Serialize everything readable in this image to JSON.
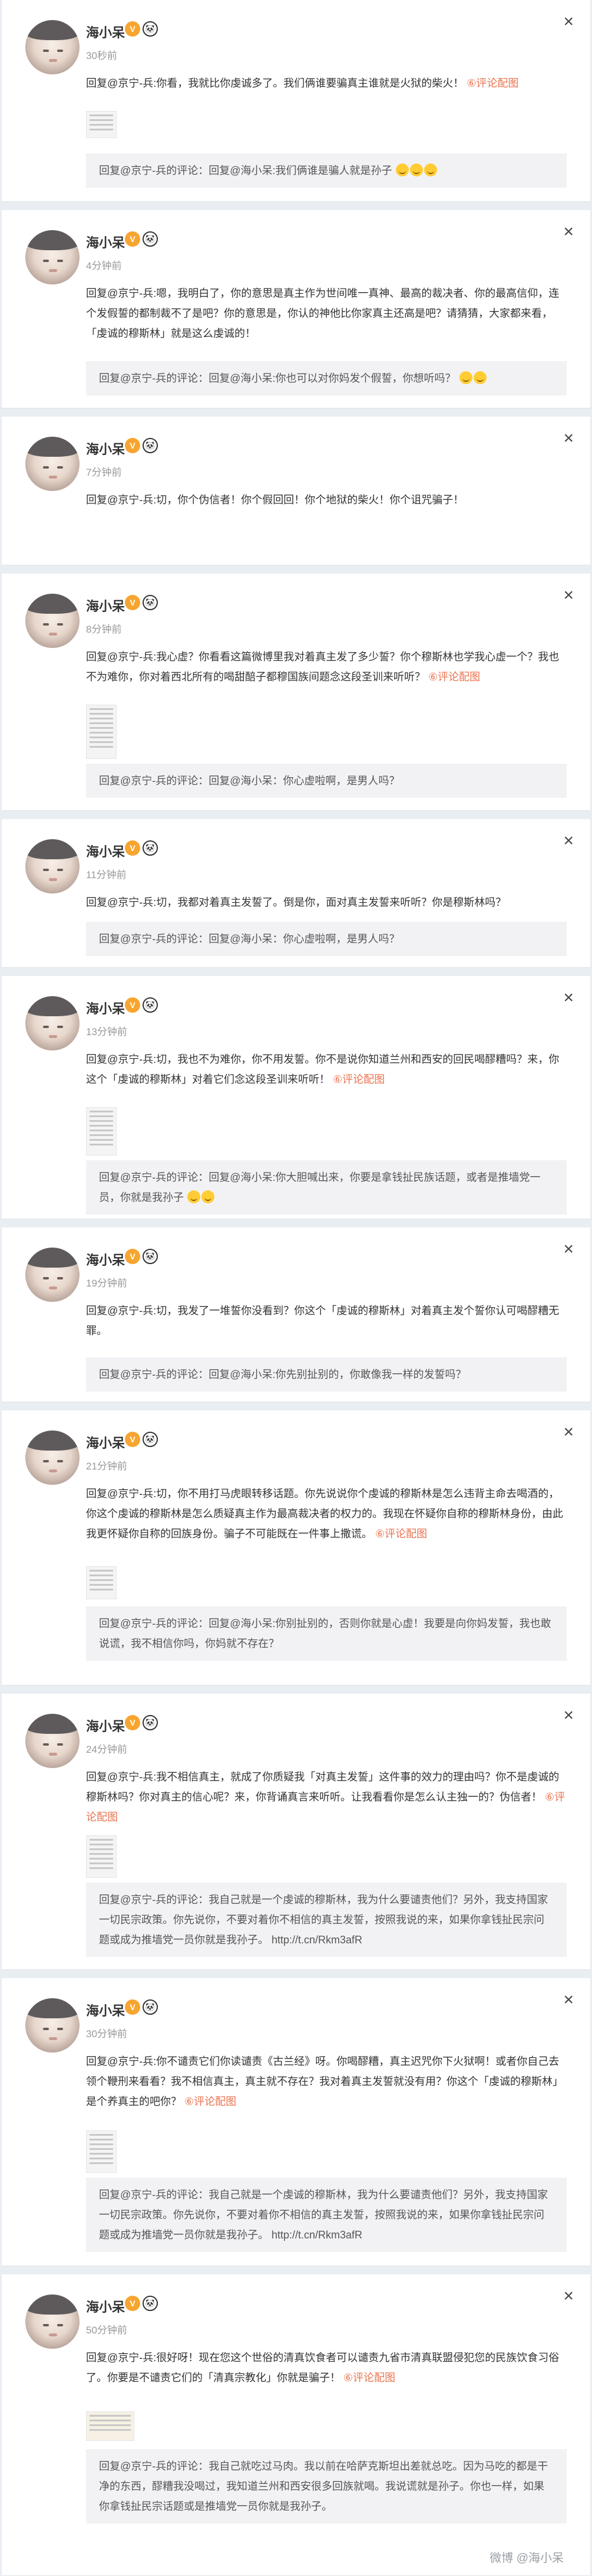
{
  "common": {
    "user_name": "海小呆",
    "verified_badge": "V",
    "panda_badge": "🐼",
    "close_glyph": "×",
    "quote_prefix": "回复@京宁-兵的评论：",
    "emoji_name": "laugh-emoji"
  },
  "posts": [
    {
      "time": "30秒前",
      "body": "回复@京宁-兵:你看，我就比你虔诚多了。我们俩谁要骗真主谁就是火狱的柴火！",
      "link": "⑥评论配图",
      "quote": "回复@京宁-兵的评论：回复@海小呆:我们俩谁是骗人就是孙子"
    },
    {
      "time": "4分钟前",
      "body": "回复@京宁-兵:嗯，我明白了，你的意思是真主作为世间唯一真神、最高的裁决者、你的最高信仰，连个发假誓的都制裁不了是吧？你的意思是，你认的神他比你家真主还高是吧？请猜猜，大家都来看，「虔诚的穆斯林」就是这么虔诚的！",
      "link": "",
      "quote": "回复@京宁-兵的评论：回复@海小呆:你也可以对你妈发个假誓，你想听吗？"
    },
    {
      "time": "7分钟前",
      "body": "回复@京宁-兵:切，你个伪信者！你个假回回！你个地狱的柴火！你个诅咒骗子！",
      "link": "",
      "quote": ""
    },
    {
      "time": "8分钟前",
      "body": "回复@京宁-兵:我心虚？你看看这篇微博里我对着真主发了多少誓？你个穆斯林也学我心虚一个？我也不为难你，你对着西北所有的喝甜醅子都穆国族间题念这段圣训来听听？",
      "link": "⑥评论配图",
      "quote": "回复@京宁-兵的评论：回复@海小呆：你心虚啦啊，是男人吗？"
    },
    {
      "time": "11分钟前",
      "body": "回复@京宁-兵:切，我都对着真主发誓了。倒是你，面对真主发誓来听听？你是穆斯林吗？",
      "link": "",
      "quote": "回复@京宁-兵的评论：回复@海小呆：你心虚啦啊，是男人吗？"
    },
    {
      "time": "13分钟前",
      "body": "回复@京宁-兵:切，我也不为难你，你不用发誓。你不是说你知道兰州和西安的回民喝醪糟吗？来，你这个「虔诚的穆斯林」对着它们念这段圣训来听听！",
      "link": "⑥评论配图",
      "quote": "回复@京宁-兵的评论：回复@海小呆:你大胆喊出来，你要是拿钱扯民族话题，或者是推墙党一员，你就是我孙子"
    },
    {
      "time": "19分钟前",
      "body": "回复@京宁-兵:切，我发了一堆誓你没看到？你这个「虔诚的穆斯林」对着真主发个誓你认可喝醪糟无罪。",
      "link": "",
      "quote": "回复@京宁-兵的评论：回复@海小呆:你先别扯别的，你敢像我一样的发誓吗？"
    },
    {
      "time": "21分钟前",
      "body": "回复@京宁-兵:切，你不用打马虎眼转移话题。你先说说你个虔诚的穆斯林是怎么违背主命去喝酒的，你这个虔诚的穆斯林是怎么质疑真主作为最高裁决者的权力的。我现在怀疑你自称的穆斯林身份，由此我更怀疑你自称的回族身份。骗子不可能既在一件事上撒谎。",
      "link": "⑥评论配图",
      "quote": "回复@京宁-兵的评论：回复@海小呆:你别扯别的，否则你就是心虚！我要是向你妈发誓，我也敢说谎，我不相信你吗，你妈就不存在？"
    },
    {
      "time": "24分钟前",
      "body": "回复@京宁-兵:我不相信真主，就成了你质疑我「对真主发誓」这件事的效力的理由吗？你不是虔诚的穆斯林吗？你对真主的信心呢？来，你背诵真言来听听。让我看看你是怎么认主独一的？伪信者！",
      "link": "⑥评论配图",
      "quote": "回复@京宁-兵的评论：我自己就是一个虔诚的穆斯林，我为什么要谴责他们？另外，我支持国家一切民宗政策。你先说你，不要对着你不相信的真主发誓，按照我说的来，如果你拿钱扯民宗问题或成为推墙党一员你就是我孙子。 http://t.cn/Rkm3afR"
    },
    {
      "time": "30分钟前",
      "body": "回复@京宁-兵:你不谴责它们你读谴责《古兰经》呀。你喝醪糟，真主迟咒你下火狱啊！或者你自己去领个鞭刑来看看？我不相信真主，真主就不存在？我对着真主发誓就没有用？你这个「虔诚的穆斯林」是个养真主的吧你？",
      "link": "⑥评论配图",
      "quote": "回复@京宁-兵的评论：我自己就是一个虔诚的穆斯林，我为什么要谴责他们？另外，我支持国家一切民宗政策。你先说你，不要对着你不相信的真主发誓，按照我说的来，如果你拿钱扯民宗问题或成为推墙党一员你就是我孙子。 http://t.cn/Rkm3afR"
    },
    {
      "time": "50分钟前",
      "body": "回复@京宁-兵:很好呀！现在您这个世俗的清真饮食者可以谴责九省市清真联盟侵犯您的民族饮食习俗了。你要是不谴责它们的「清真宗教化」你就是骗子！",
      "link": "⑥评论配图",
      "quote": "回复@京宁-兵的评论：我自己就吃过马肉。我以前在哈萨克斯坦出差就总吃。因为马吃的都是干净的东西，醪糟我没喝过，我知道兰州和西安很多回族就喝。我说谎就是孙子。你也一样，如果你拿钱扯民宗话题或是推墙党一员你就是我孙子。"
    }
  ],
  "watermark": "微博 @海小呆"
}
